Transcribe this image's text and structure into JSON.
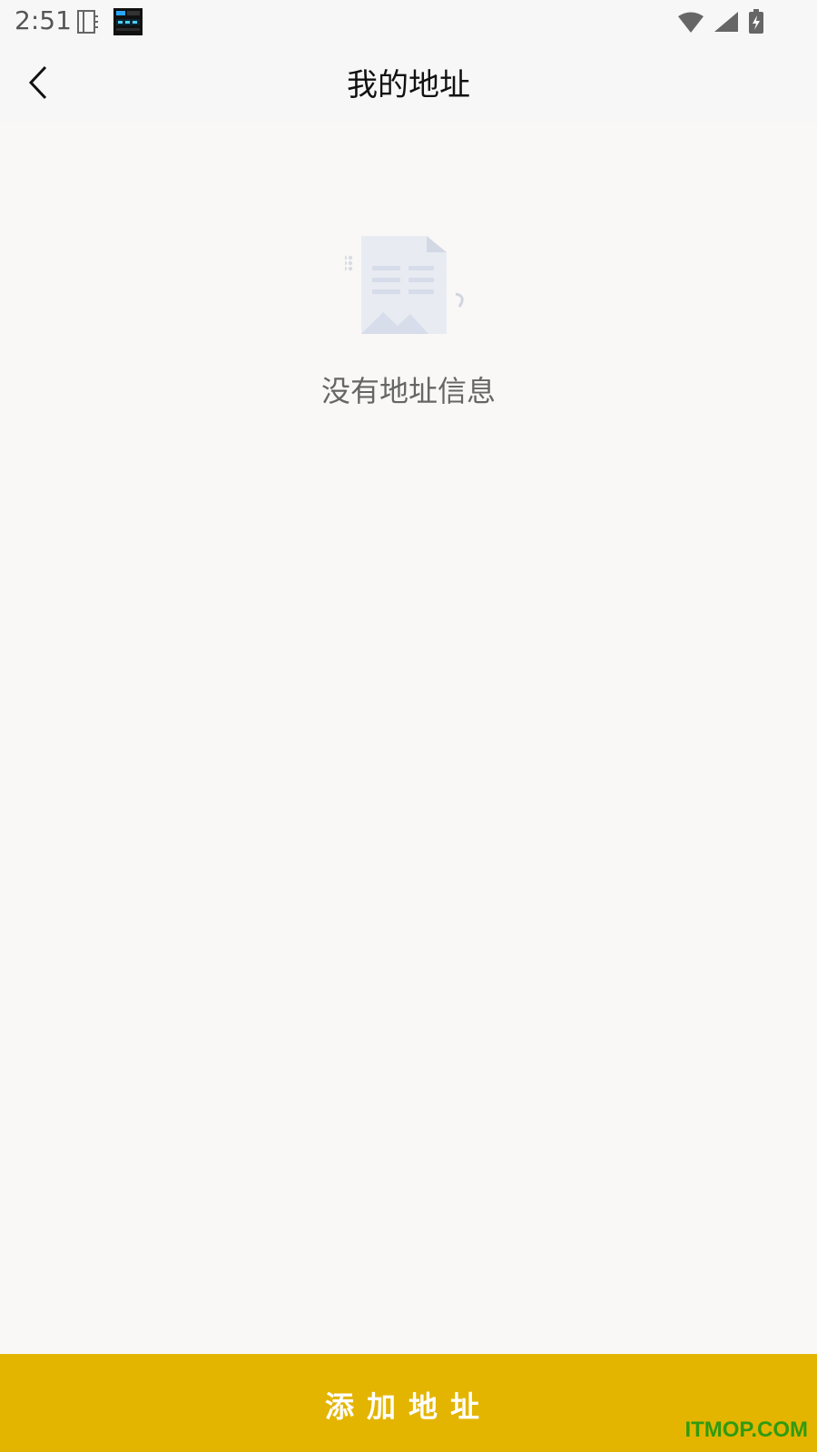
{
  "status_bar": {
    "time": "2:51",
    "left_icons": [
      "notebook-icon",
      "calendar-app-icon"
    ],
    "right_icons": [
      "wifi-icon",
      "signal-icon",
      "battery-charging-icon"
    ]
  },
  "header": {
    "back_icon": "back-chevron-icon",
    "title": "我的地址"
  },
  "empty_state": {
    "illustration": "empty-document-icon",
    "message": "没有地址信息"
  },
  "footer": {
    "add_button_label": "添加地址",
    "button_color": "#e3b500"
  },
  "watermark": {
    "text": "ITMOP.COM",
    "color": "#2f9b11"
  }
}
